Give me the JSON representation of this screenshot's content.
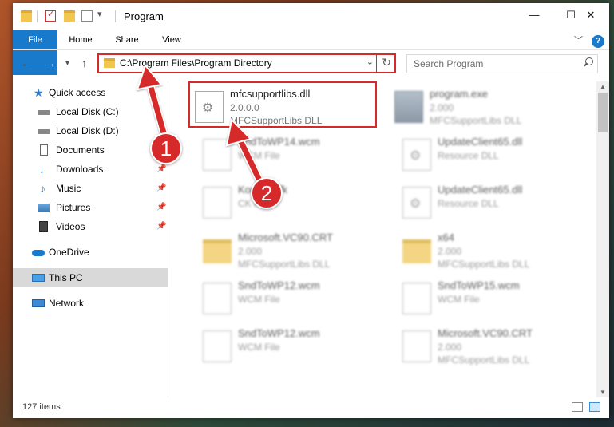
{
  "window": {
    "title": "Program",
    "minimize": "—",
    "maximize": "☐",
    "close": "✕"
  },
  "ribbon": {
    "tabs": [
      "File",
      "Home",
      "Share",
      "View"
    ],
    "expand": "﹀",
    "help": "?"
  },
  "nav": {
    "back": "←",
    "forward": "→",
    "recent": "▾",
    "up": "↑",
    "address": "C:\\Program Files\\Program Directory",
    "address_dropdown": "⌄",
    "refresh": "↻",
    "search_placeholder": "Search Program"
  },
  "sidebar": {
    "items": [
      {
        "label": "Quick access"
      },
      {
        "label": "Local Disk (C:)"
      },
      {
        "label": "Local Disk (D:)"
      },
      {
        "label": "Documents"
      },
      {
        "label": "Downloads"
      },
      {
        "label": "Music"
      },
      {
        "label": "Pictures"
      },
      {
        "label": "Videos"
      },
      {
        "label": "OneDrive"
      },
      {
        "label": "This PC"
      },
      {
        "label": "Network"
      }
    ],
    "pin": "📌"
  },
  "files": [
    {
      "name": "mfcsupportlibs.dll",
      "line1": "2.0.0.0",
      "line2": "MFCSupportLibs DLL",
      "icon": "dll-gear-icon"
    },
    {
      "name": "program.exe",
      "line1": "2.000",
      "line2": "MFCSupportLibs DLL",
      "icon": "exe-icon"
    },
    {
      "name": "SndToWP14.wcm",
      "line1": "WCM File",
      "line2": "",
      "icon": "file-icon"
    },
    {
      "name": "UpdateClient65.dll",
      "line1": "Resource DLL",
      "line2": "",
      "icon": "dll-gear-icon"
    },
    {
      "name": "Korean.cfk",
      "line1": "CK File",
      "line2": "",
      "icon": "file-icon"
    },
    {
      "name": "UpdateClient65.dll",
      "line1": "Resource DLL",
      "line2": "",
      "icon": "dll-gear-icon"
    },
    {
      "name": "Microsoft.VC90.CRT",
      "line1": "2.000",
      "line2": "MFCSupportLibs DLL",
      "icon": "folder-icon"
    },
    {
      "name": "x64",
      "line1": "2.000",
      "line2": "MFCSupportLibs DLL",
      "icon": "folder-icon"
    },
    {
      "name": "SndToWP12.wcm",
      "line1": "WCM File",
      "line2": "",
      "icon": "file-icon"
    },
    {
      "name": "SndToWP15.wcm",
      "line1": "WCM File",
      "line2": "",
      "icon": "file-icon"
    },
    {
      "name": "SndToWP12.wcm",
      "line1": "WCM File",
      "line2": "",
      "icon": "file-icon"
    },
    {
      "name": "Microsoft.VC90.CRT",
      "line1": "2.000",
      "line2": "MFCSupportLibs DLL",
      "icon": "file-icon"
    }
  ],
  "status": {
    "count": "127 items"
  },
  "callouts": {
    "one": "1",
    "two": "2"
  },
  "colors": {
    "highlight": "#d62a2a",
    "accent": "#1979ca"
  }
}
